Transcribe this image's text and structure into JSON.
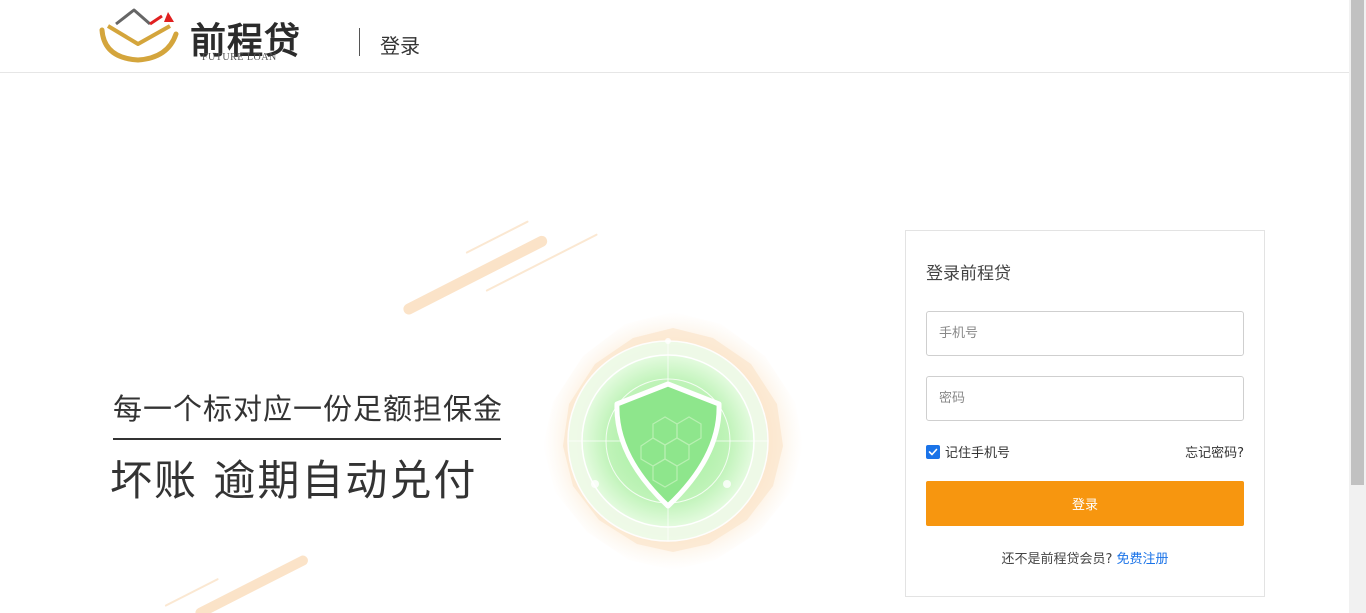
{
  "header": {
    "logo_name": "前程贷",
    "logo_sub": "FUTURE LOAN",
    "page_title": "登录"
  },
  "slogan": {
    "line1": "每一个标对应一份足额担保金",
    "line2": "坏账  逾期自动兑付"
  },
  "login": {
    "title": "登录前程贷",
    "phone_placeholder": "手机号",
    "phone_value": "",
    "password_placeholder": "密码",
    "password_value": "",
    "remember_label": "记住手机号",
    "remember_checked": true,
    "forgot_label": "忘记密码?",
    "submit_label": "登录",
    "register_prompt": "还不是前程贷会员?",
    "register_link": "免费注册"
  },
  "colors": {
    "accent": "#f7960f",
    "link": "#1a73e8",
    "logo_gold": "#d4a53c",
    "logo_arrow": "#e02020",
    "shield_green": "#8ee68c"
  }
}
